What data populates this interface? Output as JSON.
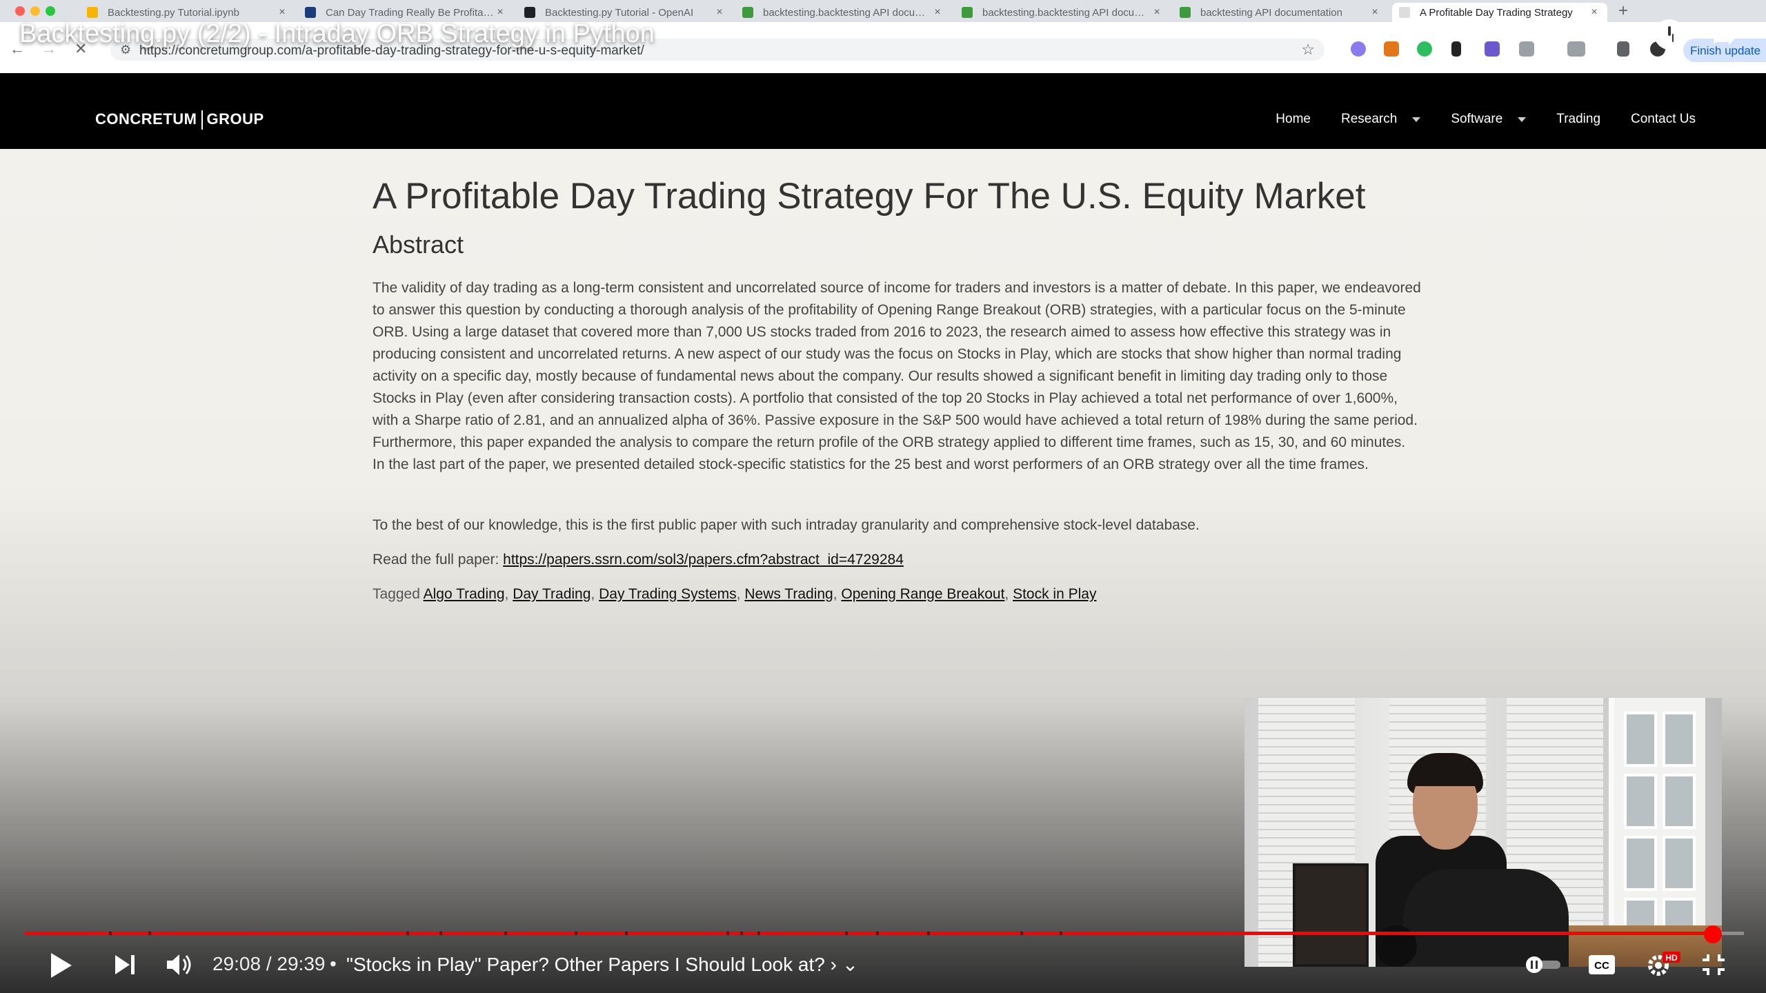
{
  "browser": {
    "tabs": [
      {
        "label": "Backtesting.py Tutorial.ipynb",
        "favicon_color": "#f4b400"
      },
      {
        "label": "Can Day Trading Really Be Profitable",
        "favicon_color": "#1a3d7c"
      },
      {
        "label": "Backtesting.py Tutorial - OpenAI",
        "favicon_color": "#202124"
      },
      {
        "label": "backtesting.backtesting API documentation",
        "favicon_color": "#3d9a3d"
      },
      {
        "label": "backtesting.backtesting API documentation",
        "favicon_color": "#3d9a3d"
      },
      {
        "label": "backtesting API documentation",
        "favicon_color": "#3d9a3d"
      },
      {
        "label": "A Profitable Day Trading Strategy",
        "favicon_color": "#dddddd"
      }
    ],
    "url": "https://concretumgroup.com/a-profitable-day-trading-strategy-for-the-u-s-equity-market/",
    "update_button": "Finish update"
  },
  "video": {
    "title": "Backtesting.py (2/2) - Intraday ORB Strategy in Python",
    "time": "29:08 / 29:39",
    "chapter": "\"Stocks in Play\" Paper? Other Papers I Should Look at?",
    "progress_fraction": 0.982,
    "chapter_breaks": [
      0.049,
      0.072,
      0.222,
      0.241,
      0.279,
      0.32,
      0.349,
      0.408,
      0.416,
      0.426,
      0.477,
      0.495,
      0.525,
      0.579,
      0.602
    ],
    "icons": [
      "play-icon",
      "next-icon",
      "volume-icon",
      "autoplay-toggle",
      "cc-icon",
      "settings-icon",
      "exit-fullscreen-icon"
    ]
  },
  "site": {
    "logo_left": "CONCRETUM",
    "logo_right": "GROUP",
    "nav": [
      {
        "label": "Home",
        "dropdown": false
      },
      {
        "label": "Research",
        "dropdown": true
      },
      {
        "label": "Software",
        "dropdown": true
      },
      {
        "label": "Trading",
        "dropdown": false
      },
      {
        "label": "Contact Us",
        "dropdown": false
      }
    ]
  },
  "article": {
    "title": "A Profitable Day Trading Strategy For The U.S. Equity Market",
    "abstract_heading": "Abstract",
    "abstract": "The validity of day trading as a long-term consistent and uncorrelated source of income for traders and investors is a matter of debate. In this paper, we endeavored to answer this question by conducting a thorough analysis of the profitability of Opening Range Breakout (ORB) strategies, with a particular focus on the 5-minute ORB. Using a large dataset that covered more than 7,000 US stocks traded from 2016 to 2023, the research aimed to assess how effective this strategy was in producing consistent and uncorrelated returns. A new aspect of our study was the focus on Stocks in Play, which are stocks that show higher than normal trading activity on a specific day, mostly because of fundamental news about the company. Our results showed a significant benefit in limiting day trading only to those Stocks in Play (even after considering transaction costs). A portfolio that consisted of the top 20 Stocks in Play achieved a total net performance of over 1,600%, with a Sharpe ratio of 2.81, and an annualized alpha of 36%. Passive exposure in the S&P 500 would have achieved a total return of 198% during the same period. Furthermore, this paper expanded the analysis to compare the return profile of the ORB strategy applied to different time frames, such as 15, 30, and 60 minutes. In the last part of the paper, we presented detailed stock-specific statistics for the 25 best and worst performers of an ORB strategy over all the time frames.",
    "knowledge": "To the best of our knowledge, this is the first public paper with such intraday granularity and comprehensive stock-level database.",
    "read_full_label": "Read the full paper:",
    "paper_link": "https://papers.ssrn.com/sol3/papers.cfm?abstract_id=4729284",
    "tagged_label": "Tagged",
    "tags": [
      "Algo Trading",
      "Day Trading",
      "Day Trading Systems",
      "News Trading",
      "Opening Range Breakout",
      "Stock in Play"
    ]
  }
}
